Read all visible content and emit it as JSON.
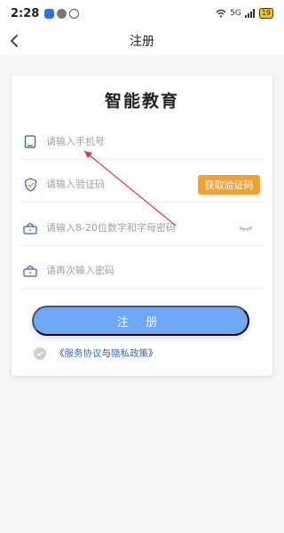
{
  "status": {
    "time": "2:28",
    "network": "5G",
    "battery": "19"
  },
  "header": {
    "title": "注册"
  },
  "card": {
    "brand": "智能教育",
    "phone": {
      "placeholder": "请输入手机号"
    },
    "code": {
      "placeholder": "请输入验证码",
      "button": "获取验证码"
    },
    "password": {
      "placeholder": "请输入8-20位数字和字母密码"
    },
    "confirm": {
      "placeholder": "请再次输入密码"
    },
    "register_button": "注 册",
    "agreement": {
      "open": "《",
      "service": "服务协议",
      "and": "与",
      "privacy": "隐私政策",
      "close": "》"
    }
  },
  "colors": {
    "accent": "#6ea7f5",
    "orange": "#f1a136",
    "link": "#2d6ad6",
    "annotation": "#d9363e"
  },
  "icons": {
    "back": "chevron-left-icon",
    "phone": "phone-icon",
    "shield": "shield-check-icon",
    "lock": "lock-icon",
    "eye": "eye-closed-icon",
    "check": "check-icon"
  }
}
